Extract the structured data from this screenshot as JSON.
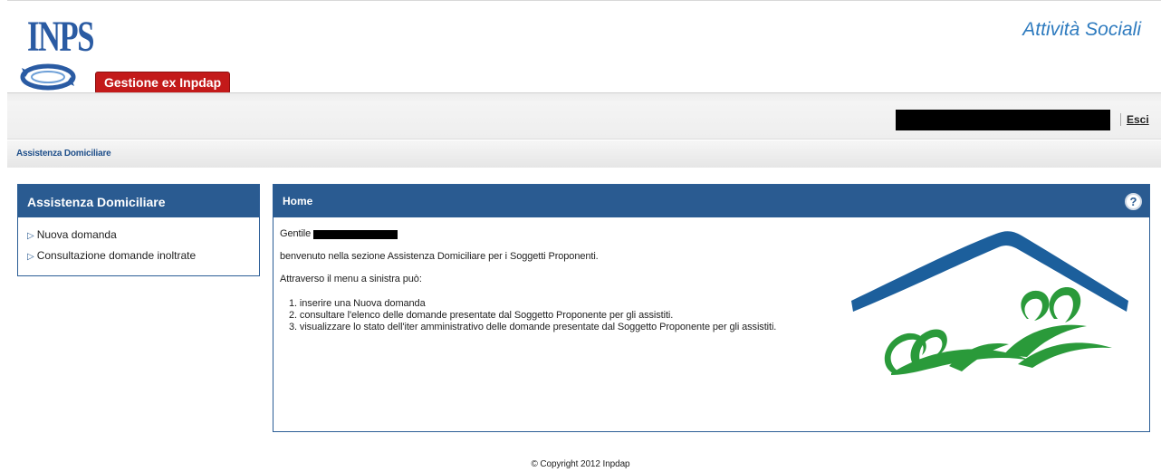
{
  "header": {
    "logo_text": "INPS",
    "badge": "Gestione ex Inpdap",
    "app_title": "Attività Sociali"
  },
  "userbar": {
    "logout": "Esci"
  },
  "breadcrumb": "Assistenza Domiciliare",
  "sidebar": {
    "title": "Assistenza Domiciliare",
    "items": [
      {
        "label": "Nuova domanda"
      },
      {
        "label": "Consultazione domande inoltrate"
      }
    ]
  },
  "panel": {
    "title": "Home",
    "help_label": "?",
    "greeting": "Gentile",
    "welcome": "benvenuto nella sezione Assistenza Domiciliare per i Soggetti Proponenti.",
    "intro": "Attraverso il menu a sinistra può:",
    "steps": [
      "1. inserire una Nuova domanda",
      "2. consultare l'elenco delle domande presentate dal Soggetto Proponente per gli assistiti.",
      "3. visualizzare lo stato dell'iter amministrativo delle domande presentate dal Soggetto Proponente per gli assistiti."
    ]
  },
  "footer": "© Copyright 2012 Inpdap",
  "colors": {
    "brand_blue": "#2a5b91",
    "title_blue": "#2e7bbf",
    "badge_red": "#c31a1a",
    "house_blue": "#1c5f9c",
    "figure_green": "#2a9a3a"
  }
}
